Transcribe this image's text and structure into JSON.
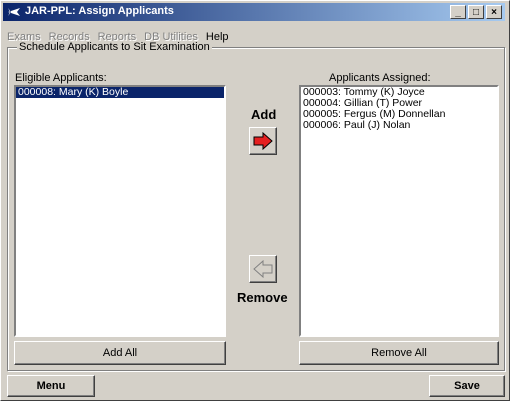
{
  "window": {
    "title": "JAR-PPL: Assign Applicants"
  },
  "menu": {
    "items": [
      {
        "label": "Exams",
        "enabled": false
      },
      {
        "label": "Records",
        "enabled": false
      },
      {
        "label": "Reports",
        "enabled": false
      },
      {
        "label": "DB Utilities",
        "enabled": false
      },
      {
        "label": "Help",
        "enabled": true
      }
    ]
  },
  "group": {
    "legend": "Schedule Applicants to Sit Examination"
  },
  "eligible": {
    "label": "Eligible Applicants:",
    "items": [
      {
        "text": "000008:  Mary (K) Boyle",
        "selected": true
      }
    ]
  },
  "assigned": {
    "label": "Applicants Assigned:",
    "items": [
      {
        "text": "000003:  Tommy (K) Joyce"
      },
      {
        "text": "000004:  Gillian (T) Power"
      },
      {
        "text": "000005:  Fergus (M) Donnellan"
      },
      {
        "text": "000006:  Paul (J) Nolan"
      }
    ]
  },
  "actions": {
    "add_label": "Add",
    "remove_label": "Remove",
    "add_all_label": "Add All",
    "remove_all_label": "Remove All",
    "menu_label": "Menu",
    "save_label": "Save"
  },
  "colors": {
    "title_bar": "#0a246a",
    "selection": "#0a246a",
    "add_arrow": "#e52020",
    "face": "#d4d0c8"
  }
}
